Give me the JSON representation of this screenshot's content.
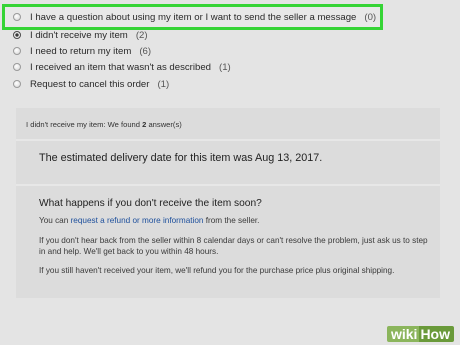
{
  "options": [
    {
      "label": "I have a question about using my item or I want to send the seller a message",
      "count": "(0)",
      "checked": false,
      "highlighted": true
    },
    {
      "label": "I didn't receive my item",
      "count": "(2)",
      "checked": true,
      "highlighted": false
    },
    {
      "label": "I need to return my item",
      "count": "(6)",
      "checked": false,
      "highlighted": false
    },
    {
      "label": "I received an item that wasn't as described",
      "count": "(1)",
      "checked": false,
      "highlighted": false
    },
    {
      "label": "Request to cancel this order",
      "count": "(1)",
      "checked": false,
      "highlighted": false
    }
  ],
  "panel": {
    "header_prefix": "I didn't receive my item: We found ",
    "header_count": "2",
    "header_suffix": " answer(s)",
    "delivery_text": "The estimated delivery date for this item was Aug 13, 2017.",
    "question_title": "What happens if you don't receive the item soon?",
    "line1_prefix": "You can ",
    "line1_link": "request a refund or more information",
    "line1_suffix": " from the seller.",
    "para2": "If you don't hear back from the seller within 8 calendar days or can't resolve the problem, just ask us to step in and help. We'll get back to you within 48 hours.",
    "para3": "If you still haven't received your item, we'll refund you for the purchase price plus original shipping."
  },
  "watermark": {
    "wiki": "wiki",
    "how": "How"
  },
  "colors": {
    "highlight_border": "#35d435",
    "link": "#1d4f9c",
    "panel_bg": "#dcdcdc",
    "page_bg": "#e4e4e4"
  }
}
